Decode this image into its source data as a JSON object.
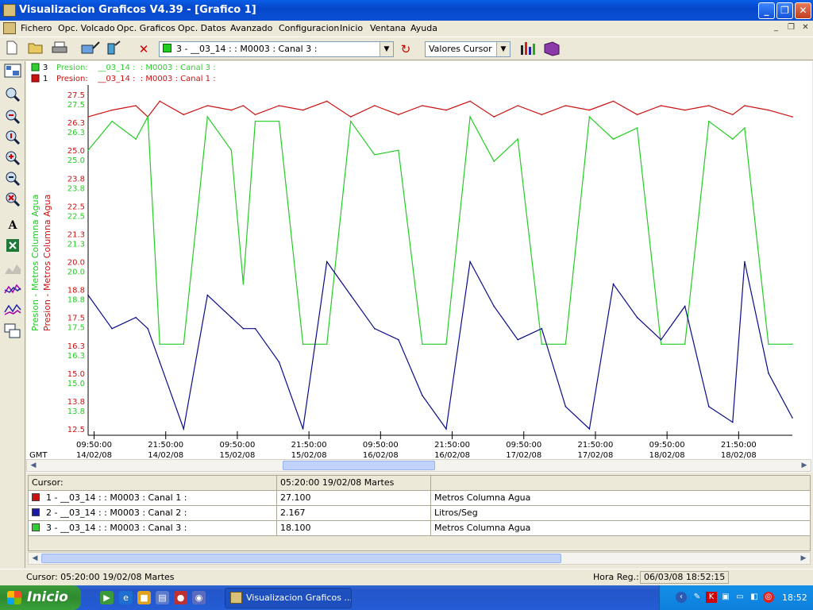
{
  "window": {
    "title": "Visualizacion Graficos V4.39 - [Grafico 1]",
    "min_glyph": "_",
    "max_glyph": "❐",
    "close_glyph": "✕"
  },
  "menu": {
    "items": [
      "Fichero",
      "Opc. Volcado",
      "Opc. Graficos",
      "Opc. Datos",
      "Avanzado",
      "Configuracion",
      "Inicio",
      "Ventana",
      "Ayuda"
    ],
    "mdi": [
      "_",
      "❐",
      "✕"
    ]
  },
  "toolbar": {
    "channel_select": "3 - __03_14 :  : M0003 : Canal 3 :",
    "value_select": "Valores Cursor",
    "icons": [
      "new-icon",
      "open-icon",
      "print-icon",
      "zoom-tool-icon",
      "pen-tool-icon",
      "delete-icon",
      "refresh-icon",
      "chart-style-icon",
      "book-icon"
    ]
  },
  "legend": [
    {
      "num": "3",
      "text": "Presion:    __03_14 :  : M0003 : Canal 3 :",
      "color": "#33cc33"
    },
    {
      "num": "1",
      "text": "Presion:    __03_14 :  : M0003 : Canal 1 :",
      "color": "#cc1111"
    }
  ],
  "colors": {
    "red": "#cc1111",
    "green": "#22cc22",
    "blue": "#0b0b8a"
  },
  "chart_data": {
    "type": "line",
    "y_axis_label_green": "Presion - Metros Columna Agua",
    "y_axis_label_red": "Presion - Metros Columna Agua",
    "y_ticks_red": [
      "27.5",
      "26.3",
      "25.0",
      "23.8",
      "22.5",
      "21.3",
      "20.0",
      "18.8",
      "17.5",
      "16.3",
      "15.0",
      "13.8",
      "12.5"
    ],
    "y_ticks_green": [
      "27.5",
      "26.3",
      "25.0",
      "23.8",
      "22.5",
      "21.3",
      "20.0",
      "18.8",
      "17.5",
      "16.3",
      "15.0",
      "13.8",
      "12.5"
    ],
    "ylim": [
      12.5,
      27.5
    ],
    "gmt_label": "GMT",
    "x_ticks": [
      {
        "time": "09:50:00",
        "date": "14/02/08"
      },
      {
        "time": "21:50:00",
        "date": "14/02/08"
      },
      {
        "time": "09:50:00",
        "date": "15/02/08"
      },
      {
        "time": "21:50:00",
        "date": "15/02/08"
      },
      {
        "time": "09:50:00",
        "date": "16/02/08"
      },
      {
        "time": "21:50:00",
        "date": "16/02/08"
      },
      {
        "time": "09:50:00",
        "date": "17/02/08"
      },
      {
        "time": "21:50:00",
        "date": "17/02/08"
      },
      {
        "time": "09:50:00",
        "date": "18/02/08"
      },
      {
        "time": "21:50:00",
        "date": "18/02/08"
      }
    ],
    "x_hours": [
      0,
      4,
      8,
      10,
      12,
      16,
      20,
      24,
      26,
      28,
      32,
      36,
      40,
      44,
      48,
      52,
      56,
      60,
      64,
      68,
      72,
      76,
      80,
      84,
      88,
      92,
      96,
      100,
      104,
      108,
      110,
      114,
      118
    ],
    "series": [
      {
        "name": "1 - __03_14 :  : M0003 : Canal 1 :",
        "values": [
          26.5,
          26.8,
          27.0,
          26.5,
          27.2,
          26.6,
          27.0,
          26.8,
          27.0,
          26.6,
          27.0,
          26.8,
          27.2,
          26.5,
          27.0,
          26.6,
          27.0,
          26.8,
          27.2,
          26.5,
          27.0,
          26.6,
          27.0,
          26.8,
          27.2,
          26.6,
          27.0,
          26.8,
          27.0,
          26.6,
          27.0,
          26.8,
          26.5
        ]
      },
      {
        "name": "3 - __03_14 :  : M0003 : Canal 3 :",
        "values": [
          25.0,
          26.3,
          25.5,
          26.5,
          16.3,
          16.3,
          26.5,
          25.0,
          19.0,
          26.3,
          26.3,
          16.3,
          16.3,
          26.3,
          24.8,
          25.0,
          16.3,
          16.3,
          26.5,
          24.5,
          25.5,
          16.3,
          16.3,
          26.5,
          25.5,
          26.0,
          16.3,
          16.3,
          26.3,
          25.5,
          26.0,
          16.3,
          16.3
        ]
      },
      {
        "name": "2 - __03_14 :  : M0003 : Canal 2 :",
        "values": [
          18.5,
          17.0,
          17.5,
          17.0,
          15.5,
          12.5,
          18.5,
          17.5,
          17.0,
          17.0,
          15.5,
          12.5,
          20.0,
          18.5,
          17.0,
          16.5,
          14.0,
          12.5,
          20.0,
          18.0,
          16.5,
          17.0,
          13.5,
          12.5,
          19.0,
          17.5,
          16.5,
          18.0,
          13.5,
          12.8,
          20.0,
          15.0,
          13.0
        ]
      }
    ]
  },
  "cursor_table": {
    "header_label": "Cursor:",
    "header_time": "05:20:00 19/02/08 Martes",
    "rows": [
      {
        "label": "1 - __03_14 :  : M0003 : Canal 1 :",
        "value": "27.100",
        "unit": "Metros Columna Agua",
        "color": "#cc1111"
      },
      {
        "label": "2 - __03_14 :  : M0003 : Canal 2 :",
        "value": "2.167",
        "unit": "Litros/Seg",
        "color": "#1a1aaa"
      },
      {
        "label": "3 - __03_14 :  : M0003 : Canal 3 :",
        "value": "18.100",
        "unit": "Metros Columna Agua",
        "color": "#33cc33"
      }
    ]
  },
  "status": {
    "cursor": "Cursor: 05:20:00 19/02/08 Martes",
    "hora_label": "Hora Reg.:",
    "hora_value": "06/03/08  18:52:15"
  },
  "taskbar": {
    "start": "Inicio",
    "task": "Visualizacion Graficos ...",
    "lang": "ES",
    "clock": "18:52"
  }
}
